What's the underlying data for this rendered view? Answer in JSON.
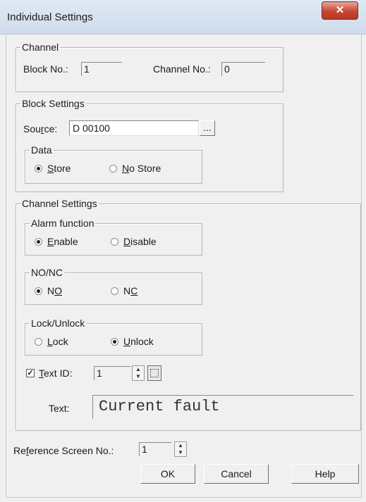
{
  "window": {
    "title": "Individual Settings",
    "close_glyph": "✕"
  },
  "channel": {
    "legend": "Channel",
    "block_no_label": "Block No.:",
    "block_no_value": "1",
    "channel_no_label": "Channel No.:",
    "channel_no_value": "0"
  },
  "block_settings": {
    "legend": "Block Settings",
    "source_label_pre": "Sou",
    "source_label_u": "r",
    "source_label_post": "ce:",
    "source_value": "D 00100",
    "browse_label": "...",
    "data": {
      "legend": "Data",
      "options": [
        {
          "u": "S",
          "rest": "tore",
          "pre": "",
          "selected": true
        },
        {
          "pre": "",
          "u": "N",
          "rest": "o Store",
          "selected": false
        }
      ]
    }
  },
  "channel_settings": {
    "legend": "Channel Settings",
    "alarm": {
      "legend": "Alarm function",
      "options": [
        {
          "pre": "",
          "u": "E",
          "rest": "nable",
          "selected": true
        },
        {
          "pre": "",
          "u": "D",
          "rest": "isable",
          "selected": false
        }
      ]
    },
    "nonc": {
      "legend": "NO/NC",
      "options": [
        {
          "pre": "N",
          "u": "O",
          "rest": "",
          "selected": true
        },
        {
          "pre": "N",
          "u": "C",
          "rest": "",
          "selected": false
        }
      ]
    },
    "lock": {
      "legend": "Lock/Unlock",
      "options": [
        {
          "pre": "",
          "u": "L",
          "rest": "ock",
          "selected": false
        },
        {
          "pre": "",
          "u": "U",
          "rest": "nlock",
          "selected": true
        }
      ]
    },
    "text_id": {
      "checked": true,
      "label_u": "T",
      "label_rest": "ext ID:",
      "value": "1"
    },
    "text": {
      "label": "Text:",
      "value": "Current fault"
    }
  },
  "reference": {
    "label_pre": "Re",
    "label_u": "f",
    "label_post": "erence Screen No.:",
    "value": "1"
  },
  "buttons": {
    "ok": "OK",
    "cancel": "Cancel",
    "help": "Help"
  },
  "spinner_glyphs": {
    "up": "▲",
    "down": "▼"
  },
  "checkmark": "✓"
}
